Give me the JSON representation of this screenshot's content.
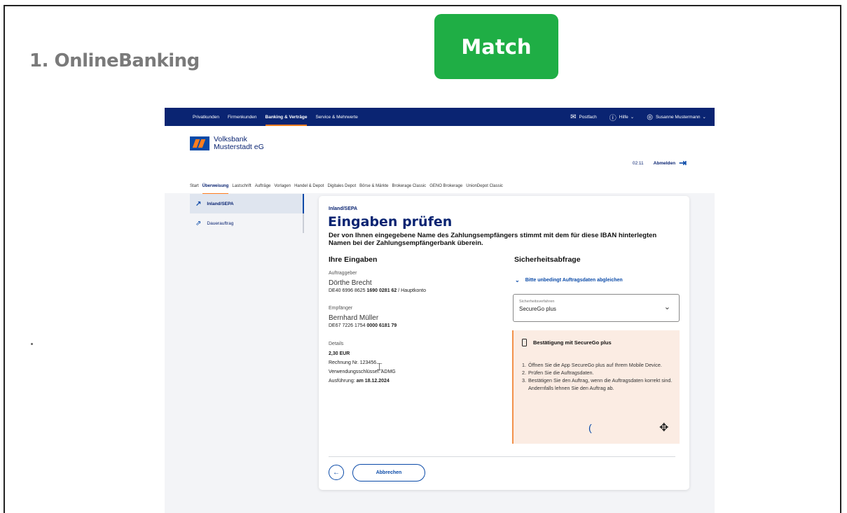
{
  "slide": {
    "title": "1. OnlineBanking",
    "badge": "Match",
    "badge_color": "#1fae45"
  },
  "colors": {
    "brand_navy": "#0a2472",
    "brand_blue": "#0a4aa8",
    "accent_orange": "#ff7d1e",
    "confirm_bg": "#fbece3"
  },
  "topnav": {
    "items": [
      "Privatkunden",
      "Firmenkunden",
      "Banking & Verträge",
      "Service & Mehrwerte"
    ],
    "active_index": 2,
    "postfach": "Postfach",
    "hilfe": "Hilfe",
    "user": "Susanne Mustermann"
  },
  "header": {
    "bank_name_line1": "Volksbank",
    "bank_name_line2": "Musterstadt eG",
    "timer": "02:11",
    "logout": "Abmelden"
  },
  "subnav": {
    "items": [
      "Start",
      "Überweisung",
      "Lastschrift",
      "Aufträge",
      "Vorlagen",
      "Handel & Depot",
      "Digitales Depot",
      "Börse & Märkte",
      "Brokerage Classic",
      "GENO Brokerage",
      "UnionDepot Classic"
    ],
    "active_index": 1
  },
  "sidebar": {
    "items": [
      {
        "label": "Inland/SEPA",
        "icon": "arrow-up-right-icon"
      },
      {
        "label": "Dauerauftrag",
        "icon": "double-arrow-up-right-icon"
      }
    ]
  },
  "card": {
    "breadcrumb": "Inland/SEPA",
    "title": "Eingaben prüfen",
    "description": "Der von Ihnen eingegebene Name des Zahlungsempfängers stimmt mit dem für diese IBAN hinterlegten Namen bei der Zahlungsempfängerbank überein.",
    "inputs_heading": "Ihre Eingaben",
    "auftraggeber_label": "Auftraggeber",
    "auftraggeber_name": "Dörthe Brecht",
    "auftraggeber_iban_prefix": "DE40 6996 8625",
    "auftraggeber_iban_bold": "1690 0281 62",
    "auftraggeber_suffix": "/ Hauptkonto",
    "empfaenger_label": "Empfänger",
    "empfaenger_name": "Bernhard Müller",
    "empfaenger_iban_prefix": "DE67 7226 1754",
    "empfaenger_iban_bold": "0000 6181 79",
    "details_label": "Details",
    "amount": "2,30 EUR",
    "reference": "Rechnung Nr. 123456",
    "purpose": "Verwendungsschlüssel: ADMG",
    "execution_label": "Ausführung:",
    "execution_date": "am 18.12.2024",
    "security_heading": "Sicherheitsabfrage",
    "check_link": "Bitte unbedingt Auftragsdaten abgleichen",
    "select_label": "Sicherheitsverfahren",
    "select_value": "SecureGo plus",
    "confirm_heading": "Bestätigung mit SecureGo plus",
    "steps": [
      "Öffnen Sie die App SecureGo plus auf Ihrem Mobile Device.",
      "Prüfen Sie die Auftragsdaten.",
      "Bestätigen Sie den Auftrag, wenn die Auftragsdaten korrekt sind. Andernfalls lehnen Sie den Auftrag ab."
    ],
    "cancel_button": "Abbrechen"
  }
}
